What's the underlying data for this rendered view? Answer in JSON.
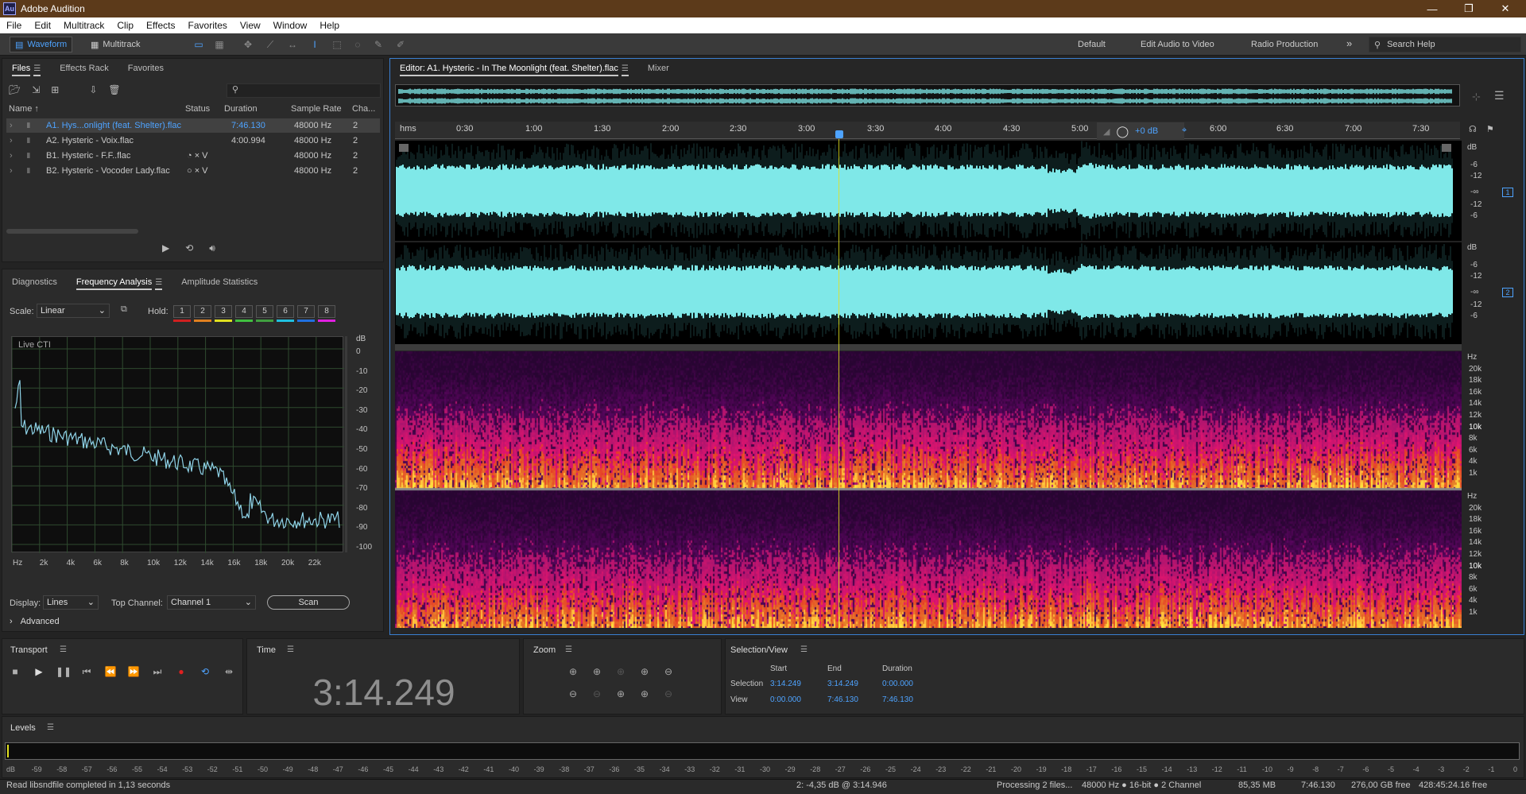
{
  "app": {
    "title": "Adobe Audition",
    "logo": "Au"
  },
  "window_controls": {
    "minimize": "—",
    "maximize": "❐",
    "close": "✕"
  },
  "menu": [
    "File",
    "Edit",
    "Multitrack",
    "Clip",
    "Effects",
    "Favorites",
    "View",
    "Window",
    "Help"
  ],
  "toolbar": {
    "waveform_label": "Waveform",
    "multitrack_label": "Multitrack",
    "workspaces": [
      "Default",
      "Edit Audio to Video",
      "Radio Production"
    ],
    "more": "»",
    "search_placeholder": "Search Help"
  },
  "files_panel": {
    "tabs": [
      "Files",
      "Effects Rack",
      "Favorites"
    ],
    "search_icon": "⚲",
    "columns": [
      "Name ↑",
      "Status",
      "Duration",
      "Sample Rate",
      "Cha..."
    ],
    "rows": [
      {
        "name": "A1. Hys...onlight (feat. Shelter).flac",
        "status": "",
        "duration": "7:46.130",
        "rate": "48000 Hz",
        "ch": "2",
        "selected": true
      },
      {
        "name": "A2. Hysteric - Voix.flac",
        "status": "",
        "duration": "4:00.994",
        "rate": "48000 Hz",
        "ch": "2",
        "selected": false
      },
      {
        "name": "B1. Hysteric - F.F..flac",
        "status": "◔ × V",
        "duration": "",
        "rate": "48000 Hz",
        "ch": "2",
        "selected": false
      },
      {
        "name": "B2. Hysteric - Vocoder Lady.flac",
        "status": "○ × V",
        "duration": "",
        "rate": "48000 Hz",
        "ch": "2",
        "selected": false
      }
    ]
  },
  "analysis_panel": {
    "tabs": [
      "Diagnostics",
      "Frequency Analysis",
      "Amplitude Statistics"
    ],
    "scale_label": "Scale:",
    "scale_value": "Linear",
    "hold_label": "Hold:",
    "holds": [
      {
        "n": "1",
        "color": "#d02020"
      },
      {
        "n": "2",
        "color": "#e08020"
      },
      {
        "n": "3",
        "color": "#e0e020"
      },
      {
        "n": "4",
        "color": "#40c040"
      },
      {
        "n": "5",
        "color": "#40a040"
      },
      {
        "n": "6",
        "color": "#20c0e0"
      },
      {
        "n": "7",
        "color": "#2070e0"
      },
      {
        "n": "8",
        "color": "#e020e0"
      }
    ],
    "graph_label": "Live CTI",
    "db_unit": "dB",
    "db_ticks": [
      "0",
      "-10",
      "-20",
      "-30",
      "-40",
      "-50",
      "-60",
      "-70",
      "-80",
      "-90",
      "-100"
    ],
    "hz_ticks": [
      "Hz",
      "2k",
      "4k",
      "6k",
      "8k",
      "10k",
      "12k",
      "14k",
      "16k",
      "18k",
      "20k",
      "22k"
    ],
    "display_label": "Display:",
    "display_value": "Lines",
    "top_channel_label": "Top Channel:",
    "top_channel_value": "Channel 1",
    "scan_label": "Scan",
    "advanced_label": "Advanced",
    "line_color": "#8fd3e8"
  },
  "editor": {
    "tab_label": "Editor: A1. Hysteric - In The Moonlight (feat. Shelter).flac",
    "mixer_label": "Mixer",
    "ruler": [
      "hms",
      "0:30",
      "1:00",
      "1:30",
      "2:00",
      "2:30",
      "3:00",
      "3:30",
      "4:00",
      "4:30",
      "5:00",
      "6:00",
      "6:30",
      "7:00",
      "7:30"
    ],
    "volume_label": "+0 dB",
    "wave_db_labels": [
      "dB",
      "-6",
      "-12",
      "-∞",
      "-12",
      "-6"
    ],
    "channel_badges": [
      "1",
      "2"
    ],
    "hz_labels": [
      "Hz",
      "20k",
      "18k",
      "16k",
      "14k",
      "12k",
      "10k",
      "8k",
      "6k",
      "4k",
      "1k"
    ],
    "waveform_color": "#7fe8e8",
    "playhead_color": "#e0e020"
  },
  "transport": {
    "title": "Transport"
  },
  "time_panel": {
    "title": "Time",
    "value": "3:14.249"
  },
  "zoom_panel": {
    "title": "Zoom"
  },
  "selection_view": {
    "title": "Selection/View",
    "headers": [
      "Start",
      "End",
      "Duration"
    ],
    "selection_label": "Selection",
    "selection": [
      "3:14.249",
      "3:14.249",
      "0:00.000"
    ],
    "view_label": "View",
    "view": [
      "0:00.000",
      "7:46.130",
      "7:46.130"
    ]
  },
  "levels": {
    "title": "Levels",
    "ticks": [
      "dB",
      "-59",
      "-58",
      "-57",
      "-56",
      "-55",
      "-54",
      "-53",
      "-52",
      "-51",
      "-50",
      "-49",
      "-48",
      "-47",
      "-46",
      "-45",
      "-44",
      "-43",
      "-42",
      "-41",
      "-40",
      "-39",
      "-38",
      "-37",
      "-36",
      "-35",
      "-34",
      "-33",
      "-32",
      "-31",
      "-30",
      "-29",
      "-28",
      "-27",
      "-26",
      "-25",
      "-24",
      "-23",
      "-22",
      "-21",
      "-20",
      "-19",
      "-18",
      "-17",
      "-16",
      "-15",
      "-14",
      "-13",
      "-12",
      "-11",
      "-10",
      "-9",
      "-8",
      "-7",
      "-6",
      "-5",
      "-4",
      "-3",
      "-2",
      "-1",
      "0"
    ]
  },
  "status_bar": {
    "left": "Read libsndfile completed in 1,13 seconds",
    "cursor": "2: -4,35 dB @ 3:14.946",
    "processing": "Processing 2 files...",
    "format": "48000 Hz ● 16-bit ● 2 Channel",
    "size": "85,35 MB",
    "duration": "7:46.130",
    "free": "276,00 GB free",
    "time_free": "428:45:24.16 free"
  }
}
